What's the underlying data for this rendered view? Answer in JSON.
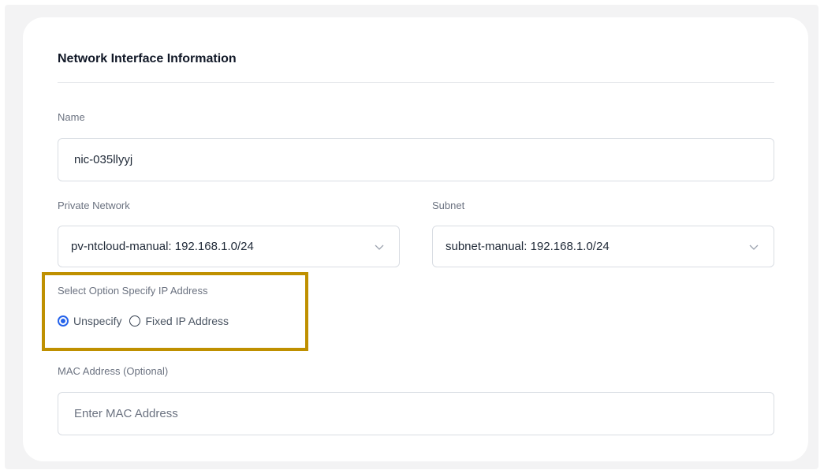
{
  "section": {
    "title": "Network Interface Information"
  },
  "name_field": {
    "label": "Name",
    "value": "nic-035llyyj"
  },
  "private_network": {
    "label": "Private Network",
    "selected": "pv-ntcloud-manual: 192.168.1.0/24"
  },
  "subnet": {
    "label": "Subnet",
    "selected": "subnet-manual: 192.168.1.0/24"
  },
  "ip_option": {
    "label": "Select Option Specify IP Address",
    "options": [
      {
        "label": "Unspecify",
        "checked": true
      },
      {
        "label": "Fixed IP Address",
        "checked": false
      }
    ]
  },
  "mac_field": {
    "label": "MAC Address (Optional)",
    "placeholder": "Enter MAC Address",
    "value": ""
  },
  "colors": {
    "accent": "#2563eb",
    "highlight": "#bf9000"
  },
  "icons": {
    "dropdown": "chevron-down-icon"
  }
}
